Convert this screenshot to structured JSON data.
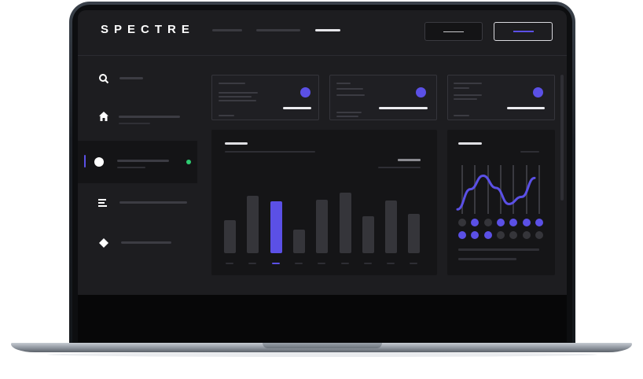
{
  "app": {
    "logo_text": "SPECTRE"
  },
  "colors": {
    "accent": "#5b50e6",
    "status": "#2ecc71",
    "surface": "#1d1d20",
    "panel": "#151517"
  },
  "header": {
    "nav_items": [
      "nav-item-1",
      "nav-item-2",
      "nav-item-3"
    ],
    "active_nav_index": 2,
    "buttons": [
      "secondary-button",
      "primary-button"
    ]
  },
  "sidebar": {
    "items": [
      {
        "icon": "search-icon",
        "selected": false
      },
      {
        "icon": "home-icon",
        "selected": false
      },
      {
        "icon": "circle-icon",
        "selected": true,
        "status": "online"
      },
      {
        "icon": "menu-icon",
        "selected": false
      },
      {
        "icon": "diamond-icon",
        "selected": false
      }
    ]
  },
  "stat_cards": [
    {
      "id": 1
    },
    {
      "id": 2
    },
    {
      "id": 3
    }
  ],
  "chart_data": [
    {
      "type": "bar",
      "categories": [
        "",
        "",
        "",
        "",
        "",
        "",
        "",
        "",
        ""
      ],
      "values": [
        45,
        79,
        71,
        32,
        73,
        83,
        50,
        72,
        54
      ],
      "highlight_index": 2
    },
    {
      "type": "line",
      "values": [
        10,
        55,
        85,
        58,
        22,
        38,
        80
      ],
      "dot_rows": [
        [
          0,
          1,
          0,
          1,
          1,
          1,
          1
        ],
        [
          1,
          1,
          1,
          0,
          0,
          0,
          0
        ]
      ]
    }
  ]
}
